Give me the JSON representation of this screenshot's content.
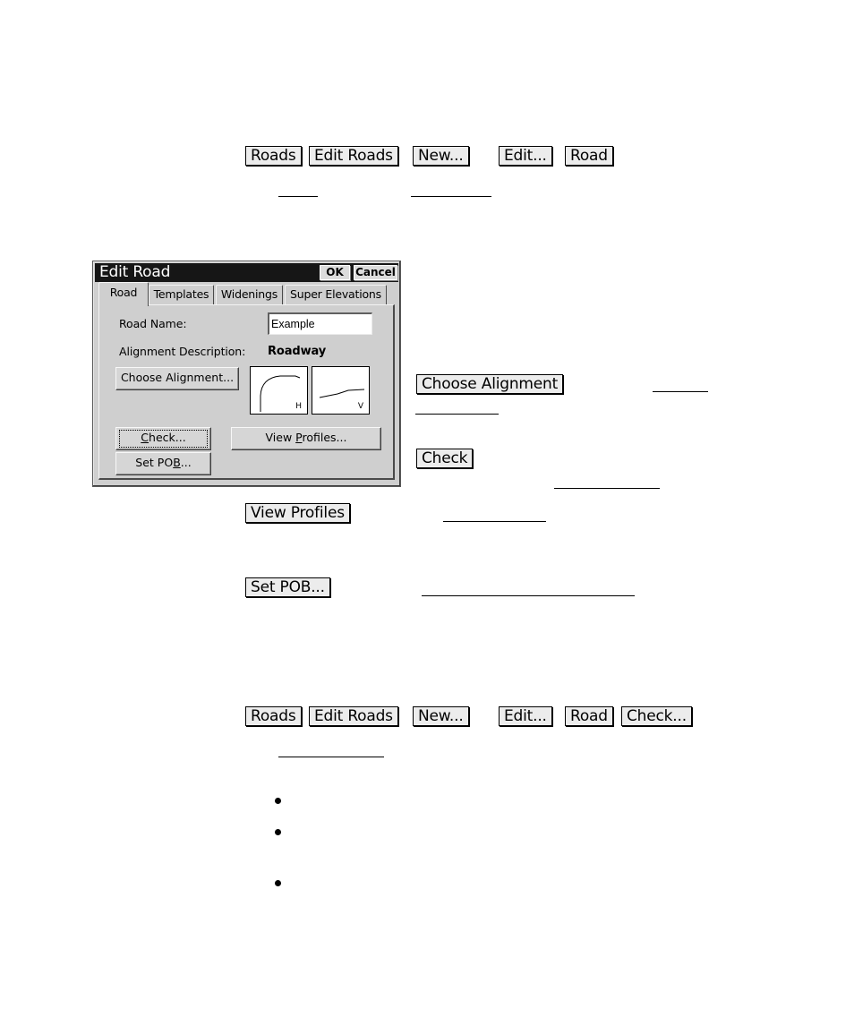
{
  "key_sequence_1": [
    "Roads",
    "Edit Roads",
    "New...",
    "Edit...",
    "Road"
  ],
  "dialog": {
    "title": "Edit Road",
    "ok_label": "OK",
    "cancel_label": "Cancel",
    "tabs": [
      {
        "label": "Road",
        "active": true
      },
      {
        "label": "Templates",
        "active": false
      },
      {
        "label": "Widenings",
        "active": false
      },
      {
        "label": "Super Elevations",
        "active": false
      }
    ],
    "road_name_label": "Road Name:",
    "road_name_value": "Example",
    "alignment_description_label": "Alignment Description:",
    "alignment_description_value": "Roadway",
    "choose_alignment_label": "Choose Alignment...",
    "horizontal_preview_tag": "H",
    "vertical_preview_tag": "V",
    "check_label_pre": "",
    "check_label_mnemonic": "C",
    "check_label_post": "heck...",
    "view_profiles_label_pre": "View ",
    "view_profiles_label_mnemonic": "P",
    "view_profiles_label_post": "rofiles...",
    "set_pob_label_pre": "Set PO",
    "set_pob_label_mnemonic": "B",
    "set_pob_label_post": "..."
  },
  "side_keys": {
    "choose_alignment": "Choose Alignment",
    "check": "Check",
    "view_profiles": "View Profiles",
    "set_pob": "Set POB..."
  },
  "key_sequence_2": [
    "Roads",
    "Edit Roads",
    "New...",
    "Edit...",
    "Road",
    "Check..."
  ],
  "bullets_count": 3
}
